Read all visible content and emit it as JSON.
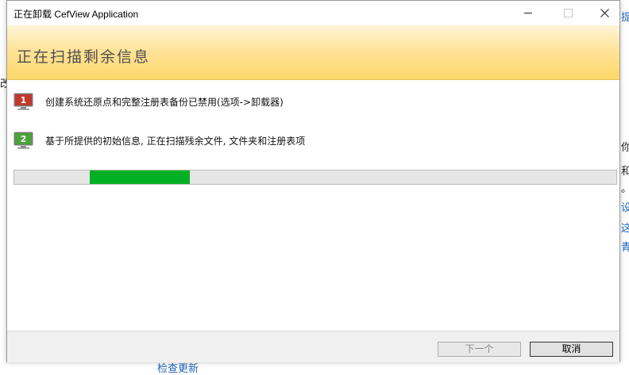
{
  "window": {
    "title": "正在卸载 CefView Application",
    "header_title": "正在扫描剩余信息"
  },
  "steps": [
    {
      "number": "1",
      "text": "创建系统还原点和完整注册表备份已禁用(选项->卸载器)",
      "icon_color": "#c0392b"
    },
    {
      "number": "2",
      "text": "基于所提供的初始信息, 正在扫描残余文件, 文件夹和注册表项",
      "icon_color": "#4aa33a"
    }
  ],
  "progress": {
    "fill_start": 0.125,
    "fill_end": 0.291,
    "fill_color": "#06b025"
  },
  "buttons": {
    "next": "下一个",
    "cancel": "取消"
  },
  "background": {
    "right_edge_glyphs": [
      "提",
      "你",
      "和",
      "。",
      "设",
      "这",
      "青"
    ],
    "left_edge_glyph": "改",
    "bottom_link": "检查更新"
  },
  "colors": {
    "banner": "#ffe39a",
    "accent_link": "#1e63b6"
  }
}
